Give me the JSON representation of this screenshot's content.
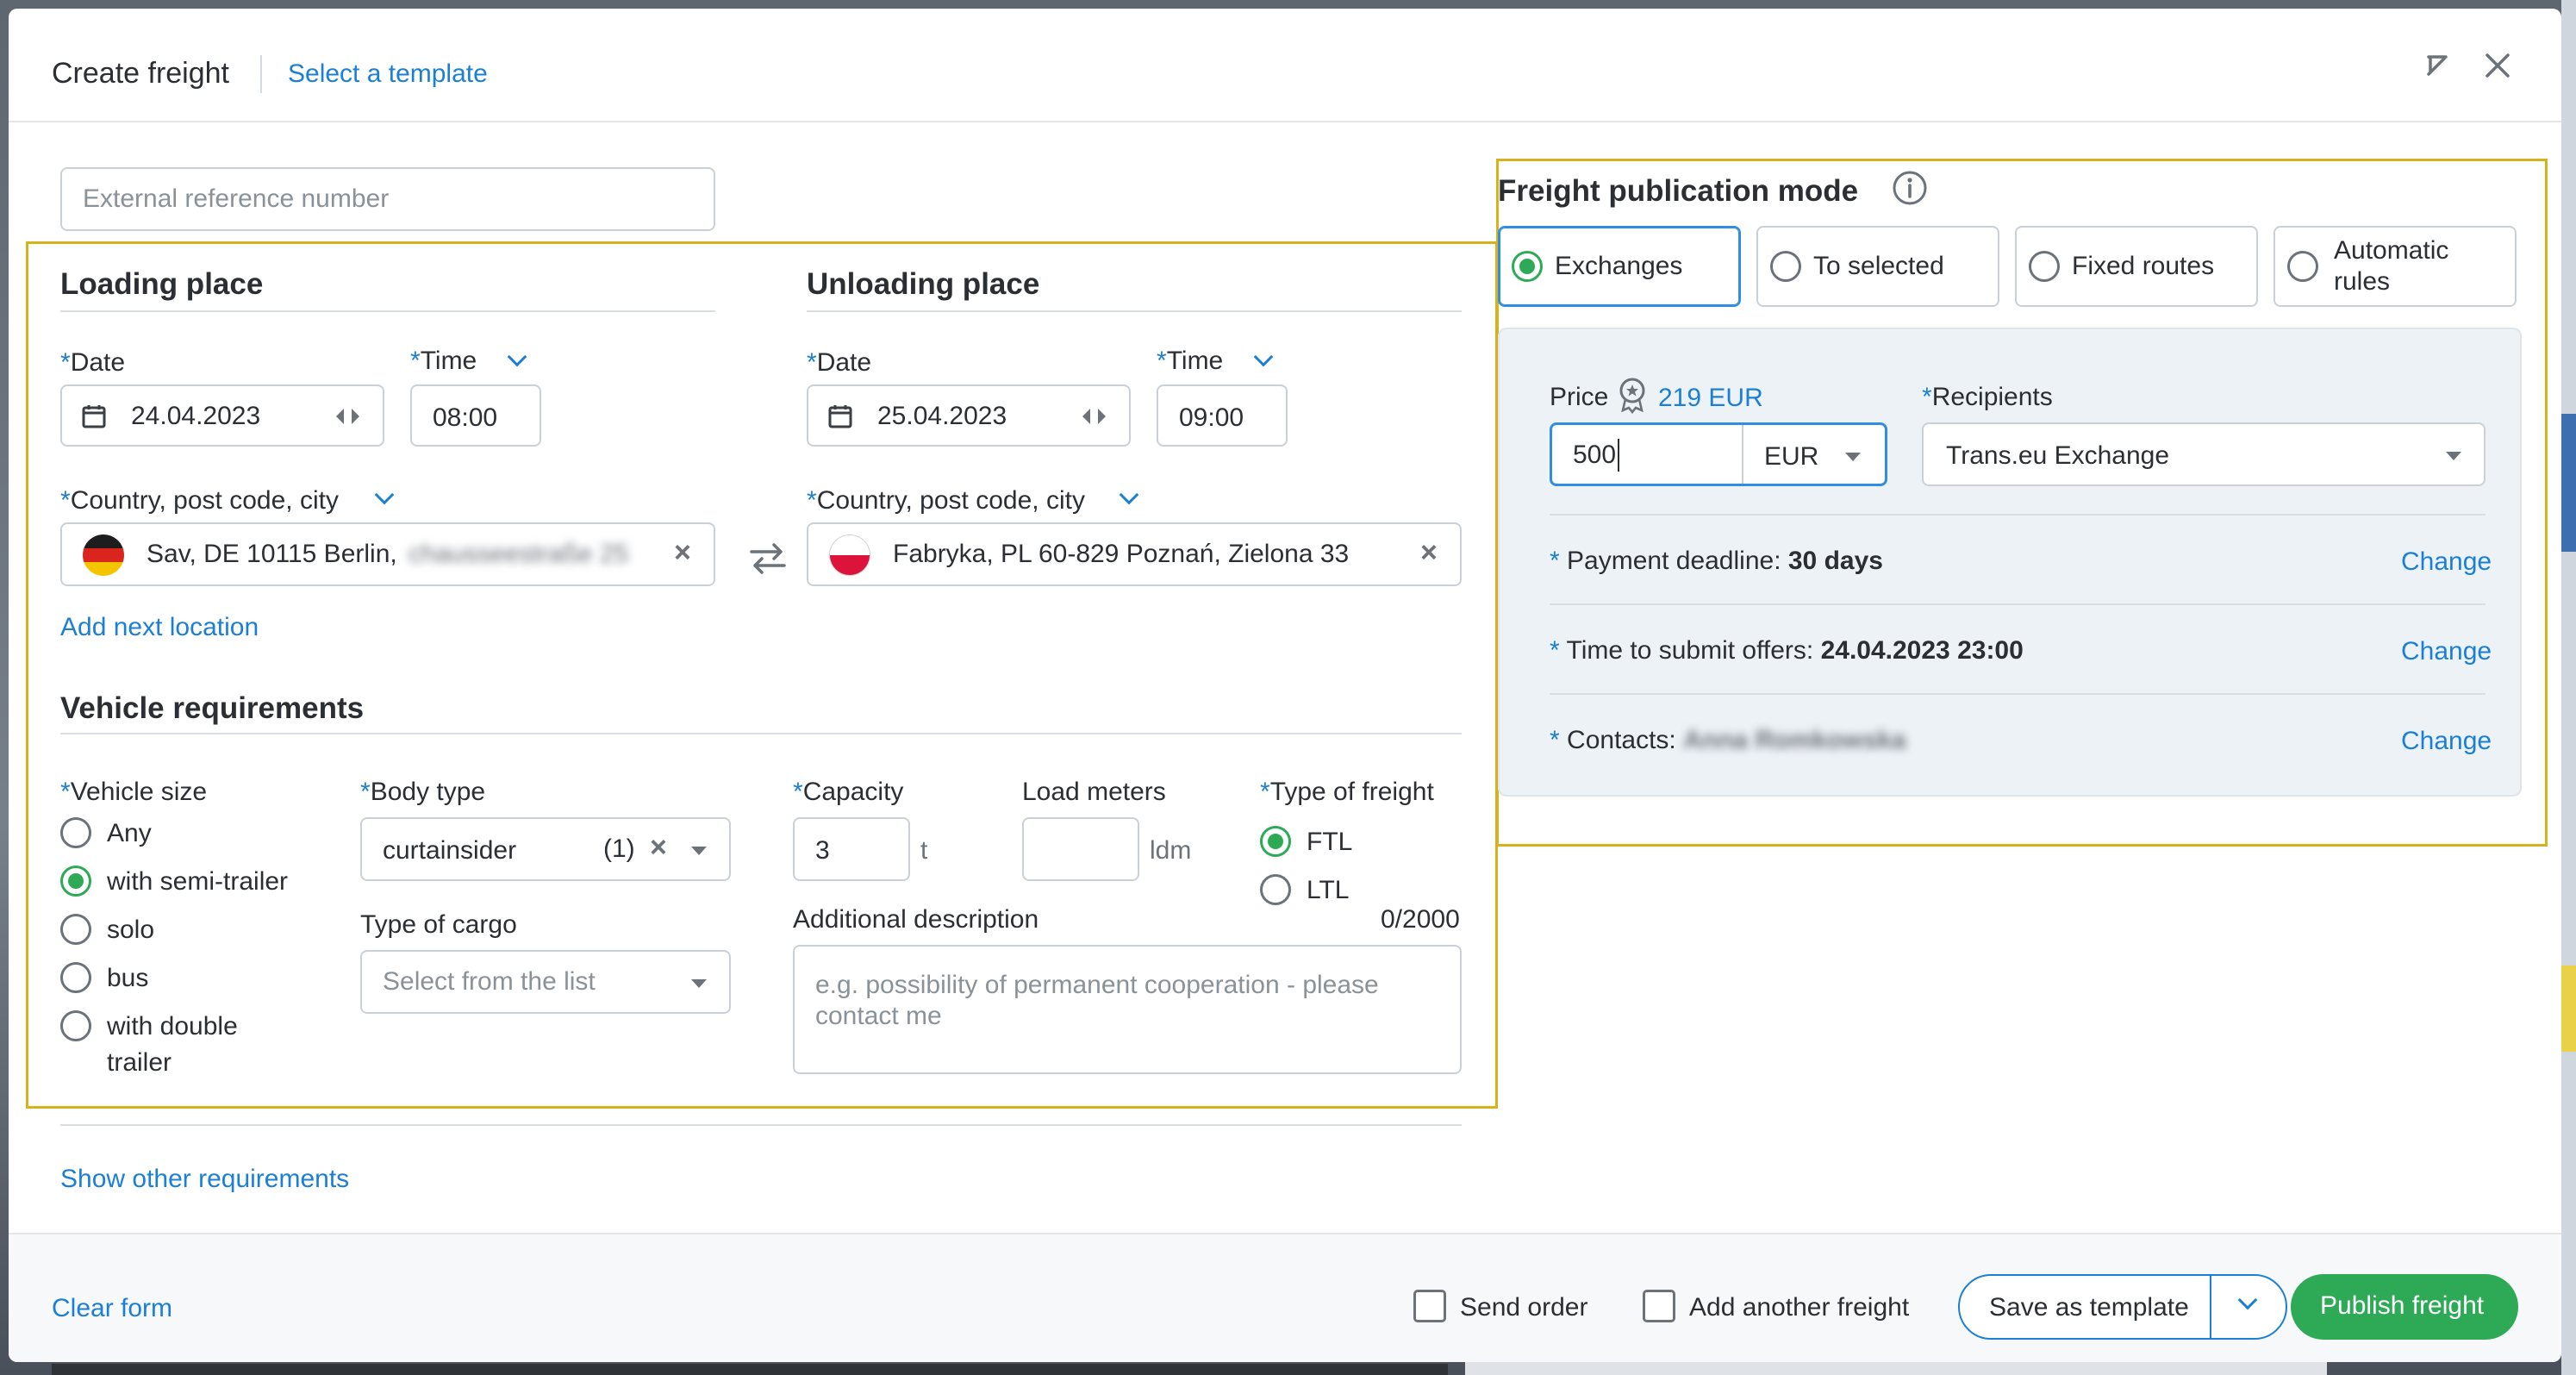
{
  "header": {
    "title": "Create freight",
    "template_link": "Select a template"
  },
  "form": {
    "external_ref_placeholder": "External reference number",
    "loading": {
      "title": "Loading place",
      "date_label": "Date",
      "date_value": "24.04.2023",
      "time_label": "Time",
      "time_value": "08:00",
      "location_label": "Country, post code, city",
      "location_value": "Sav, DE 10115 Berlin,",
      "location_blurred": "chausseestraße 25",
      "add_location": "Add next location"
    },
    "unloading": {
      "title": "Unloading place",
      "date_label": "Date",
      "date_value": "25.04.2023",
      "time_label": "Time",
      "time_value": "09:00",
      "location_label": "Country, post code, city",
      "location_value": "Fabryka, PL 60-829 Poznań, Zielona 33"
    },
    "vehicle": {
      "title": "Vehicle requirements",
      "size_label": "Vehicle size",
      "sizes": [
        "Any",
        "with semi-trailer",
        "solo",
        "bus",
        "with double",
        "trailer"
      ],
      "selected_size": "with semi-trailer",
      "body_label": "Body type",
      "body_value": "curtainsider",
      "body_count": "(1)",
      "cargo_label": "Type of cargo",
      "cargo_placeholder": "Select from the list",
      "capacity_label": "Capacity",
      "capacity_value": "3",
      "capacity_unit": "t",
      "ldm_label": "Load meters",
      "ldm_unit": "ldm",
      "freight_type_label": "Type of freight",
      "freight_types": [
        "FTL",
        "LTL"
      ],
      "selected_freight_type": "FTL",
      "desc_label": "Additional description",
      "desc_counter": "0/2000",
      "desc_placeholder_1": "e.g. possibility of permanent cooperation - please",
      "desc_placeholder_2": "contact me"
    },
    "show_other": "Show other requirements"
  },
  "publication": {
    "title": "Freight publication mode",
    "modes": [
      "Exchanges",
      "To selected",
      "Fixed routes",
      "Automatic",
      "rules"
    ],
    "selected_mode": "Exchanges",
    "price_label": "Price",
    "price_suggestion": "219 EUR",
    "price_value": "500",
    "currency": "EUR",
    "recipients_label": "Recipients",
    "recipients_value": "Trans.eu Exchange",
    "payment_label": "Payment deadline:",
    "payment_value": "30 days",
    "offers_label": "Time to submit offers:",
    "offers_value": "24.04.2023 23:00",
    "contacts_label": "Contacts:",
    "contacts_value": "Anna Romkowska",
    "change": "Change"
  },
  "footer": {
    "clear": "Clear form",
    "send_order": "Send order",
    "add_another": "Add another freight",
    "save_template": "Save as template",
    "publish": "Publish freight"
  },
  "colors": {
    "accent": "#1b7fd6",
    "success": "#2eaa57",
    "highlight": "#d6b21c"
  }
}
